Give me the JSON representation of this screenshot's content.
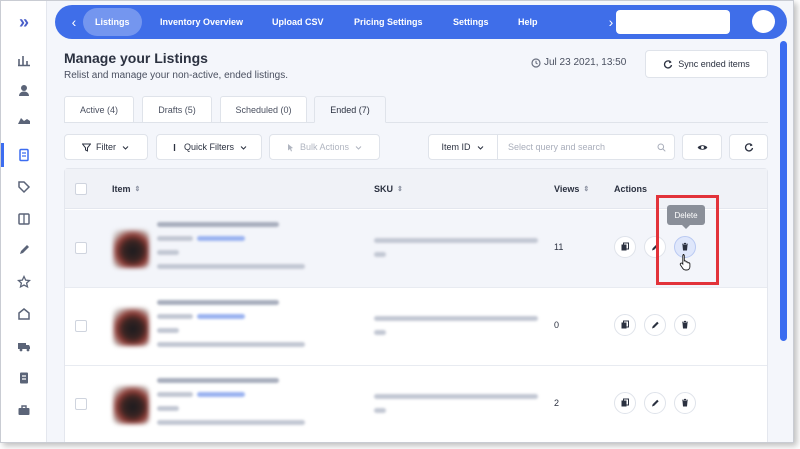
{
  "nav": {
    "tabs": [
      {
        "label": "Listings"
      },
      {
        "label": "Inventory Overview"
      },
      {
        "label": "Upload CSV"
      },
      {
        "label": "Pricing Settings"
      },
      {
        "label": "Settings"
      },
      {
        "label": "Help"
      }
    ],
    "back_icon": "chevron-left-icon",
    "forward_icon": "chevron-right-icon"
  },
  "header": {
    "title": "Manage your Listings",
    "subtitle": "Relist and manage your non-active, ended listings.",
    "timestamp": "Jul 23 2021, 13:50",
    "sync_label": "Sync ended items"
  },
  "tabs": [
    {
      "label": "Active (4)"
    },
    {
      "label": "Drafts (5)"
    },
    {
      "label": "Scheduled (0)"
    },
    {
      "label": "Ended (7)"
    }
  ],
  "toolbar": {
    "filter": "Filter",
    "quick_filters": "Quick Filters",
    "bulk_actions": "Bulk Actions",
    "item_id": "Item ID",
    "search_placeholder": "Select query and search"
  },
  "table": {
    "columns": {
      "item": "Item",
      "sku": "SKU",
      "views": "Views",
      "actions": "Actions"
    },
    "rows": [
      {
        "views": "11"
      },
      {
        "views": "0"
      },
      {
        "views": "2"
      }
    ]
  },
  "tooltip": "Delete",
  "colors": {
    "accent": "#3f6ee9",
    "highlight": "#e2333a"
  }
}
